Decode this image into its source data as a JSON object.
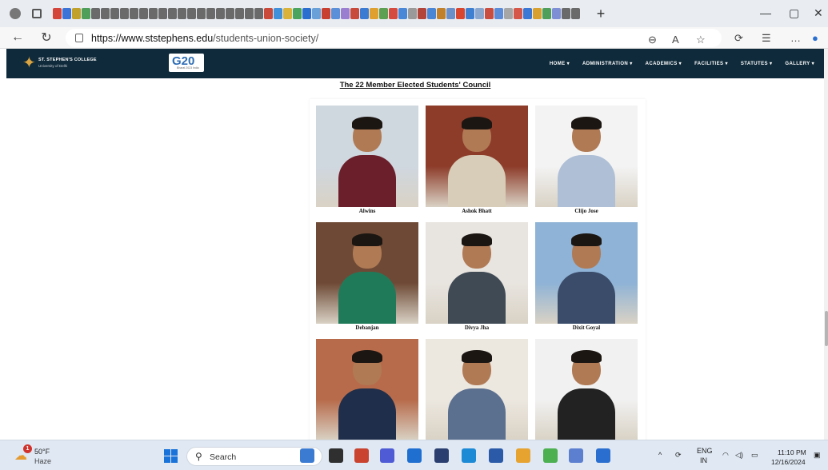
{
  "browser": {
    "url_host": "https://www.ststephens.edu",
    "url_path": "/students-union-society/",
    "tab_colors": [
      "#d4453a",
      "#3b74d6",
      "#c2a12b",
      "#4f9f5b",
      "#6a6a6a",
      "#6a6a6a",
      "#6a6a6a",
      "#6a6a6a",
      "#6a6a6a",
      "#6a6a6a",
      "#6a6a6a",
      "#6a6a6a",
      "#6a6a6a",
      "#6a6a6a",
      "#6a6a6a",
      "#6a6a6a",
      "#6a6a6a",
      "#6a6a6a",
      "#6a6a6a",
      "#6a6a6a",
      "#6a6a6a",
      "#6a6a6a",
      "#c94a3b",
      "#3f8fd9",
      "#d9b23a",
      "#4aa45d",
      "#2a6fd0",
      "#6aa0d8",
      "#c8402f",
      "#5b8fd8",
      "#9a7fd1",
      "#c84a3a",
      "#3c7bd2",
      "#e0a030",
      "#5d9f53",
      "#d64b3f",
      "#4a87d6",
      "#9a9a9a",
      "#b2443a",
      "#4a86d6",
      "#c0802c",
      "#6b8fc9",
      "#d9462f",
      "#3e7fd2",
      "#8aa6cf",
      "#c94d40",
      "#5c8bd7",
      "#a6a6a6",
      "#d4574a",
      "#3b77d5",
      "#d8a02e",
      "#4f9f5b",
      "#7f8fd6",
      "#6a6a6a",
      "#6a6a6a"
    ]
  },
  "site": {
    "college_name": "ST. STEPHEN'S COLLEGE",
    "college_sub": "University of Delhi",
    "g20_text": "G20",
    "g20_sub": "Bharat 2023 India",
    "menu": [
      "HOME ▾",
      "ADMINISTRATION ▾",
      "ACADEMICS ▾",
      "FACILITIES ▾",
      "STATUTES ▾",
      "GALLERY ▾"
    ],
    "heading": "The 22 Member Elected Students' Council",
    "members": [
      {
        "name": "Alwins",
        "bg": "#cfd7df",
        "shirt": "#6b1f2b"
      },
      {
        "name": "Ashok Bhatt",
        "bg": "#8d3c2a",
        "shirt": "#d8cdb8"
      },
      {
        "name": "Clijo Jose",
        "bg": "#f3f3f3",
        "shirt": "#aebfd6"
      },
      {
        "name": "Debanjan",
        "bg": "#6e4a36",
        "shirt": "#1f7a5a"
      },
      {
        "name": "Divya Jha",
        "bg": "#e8e4df",
        "shirt": "#3f4a55"
      },
      {
        "name": "Dixit Goyal",
        "bg": "#8fb3d6",
        "shirt": "#3a4c6a"
      },
      {
        "name": "",
        "bg": "#b76b4b",
        "shirt": "#1f2e4a"
      },
      {
        "name": "",
        "bg": "#ece7df",
        "shirt": "#5b6f8f"
      },
      {
        "name": "",
        "bg": "#f1f1f1",
        "shirt": "#222222"
      }
    ]
  },
  "taskbar": {
    "temp": "50°F",
    "weather": "Haze",
    "badge": "1",
    "search_placeholder": "Search",
    "lang": "ENG",
    "region": "IN",
    "time": "11:10 PM",
    "date": "12/16/2024",
    "apps": [
      "#3c7bd2",
      "#2f2f2f",
      "#c9432f",
      "#4f5bd5",
      "#1f6fd1",
      "#2a3f6f",
      "#1d8ad6",
      "#2b5aa8",
      "#e7a32f",
      "#4caf50",
      "#5c7fd0",
      "#2a6fd0"
    ]
  }
}
